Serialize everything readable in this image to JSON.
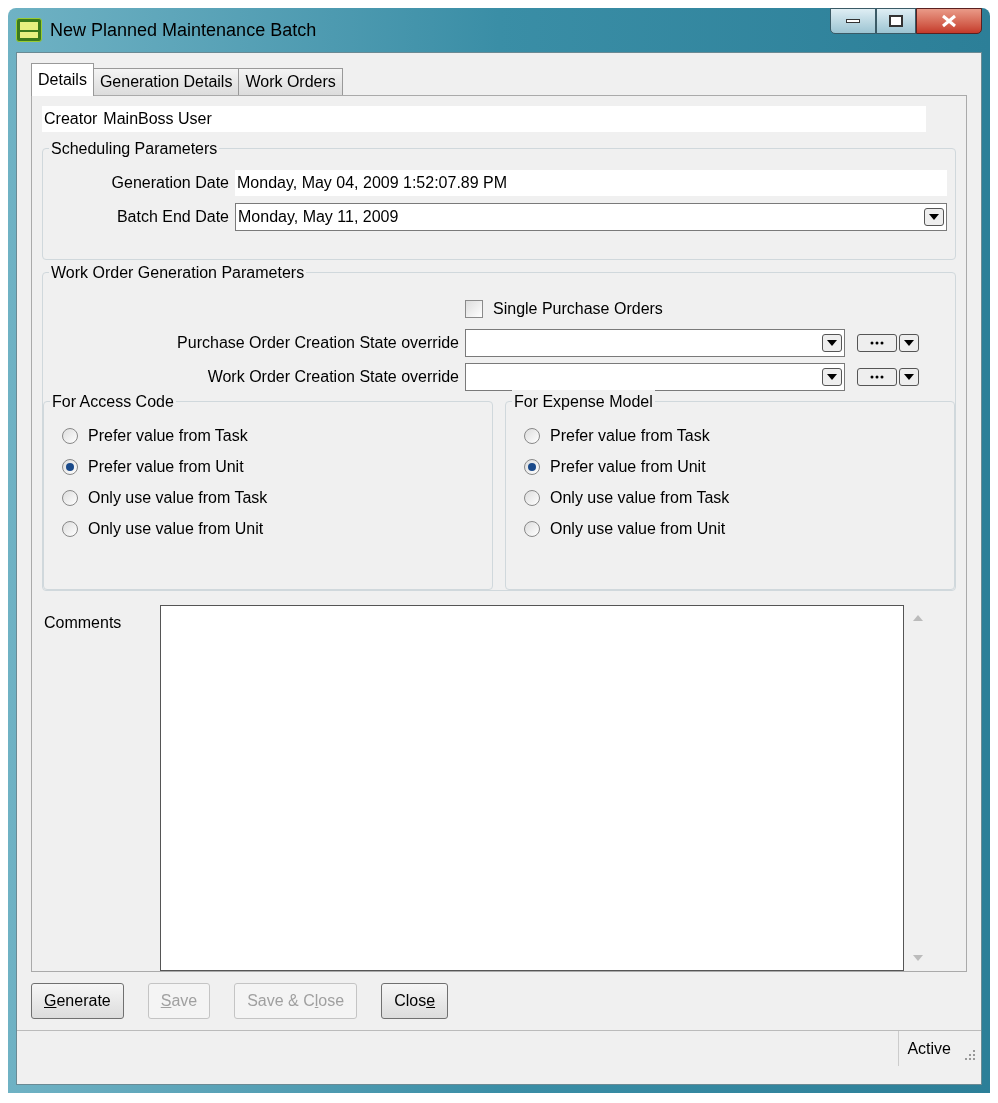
{
  "window": {
    "title": "New Planned Maintenance Batch"
  },
  "tabs": [
    {
      "label": "Details",
      "selected": true
    },
    {
      "label": "Generation Details",
      "selected": false
    },
    {
      "label": "Work Orders",
      "selected": false
    }
  ],
  "creator": {
    "label": "Creator",
    "value": "MainBoss User"
  },
  "scheduling": {
    "title": "Scheduling Parameters",
    "generation_date": {
      "label": "Generation Date",
      "value": "Monday, May 04, 2009 1:52:07.89 PM"
    },
    "batch_end_date": {
      "label": "Batch End Date",
      "value": "Monday, May 11, 2009"
    }
  },
  "generation": {
    "title": "Work Order Generation Parameters",
    "single_purchase_orders": {
      "label": "Single Purchase Orders",
      "checked": false
    },
    "overrides": [
      {
        "label": "Purchase Order Creation State override"
      },
      {
        "label": "Work Order Creation State override"
      }
    ],
    "groups": [
      {
        "title": "For Access Code",
        "options": [
          {
            "label": "Prefer value from Task",
            "selected": false
          },
          {
            "label": "Prefer value from Unit",
            "selected": true
          },
          {
            "label": "Only use value from Task",
            "selected": false
          },
          {
            "label": "Only use value from Unit",
            "selected": false
          }
        ]
      },
      {
        "title": "For Expense Model",
        "options": [
          {
            "label": "Prefer value from Task",
            "selected": false
          },
          {
            "label": "Prefer value from Unit",
            "selected": true
          },
          {
            "label": "Only use value from Task",
            "selected": false
          },
          {
            "label": "Only use value from Unit",
            "selected": false
          }
        ]
      }
    ]
  },
  "comments": {
    "label": "Comments"
  },
  "buttons": [
    {
      "access_key": "G",
      "after": "enerate",
      "disabled": false
    },
    {
      "access_key": "S",
      "after": "ave",
      "disabled": true
    },
    {
      "before": "Save & C",
      "access_key": "l",
      "after": "ose",
      "disabled": true
    },
    {
      "before": "Clos",
      "access_key": "e",
      "disabled": false
    }
  ],
  "status_bar": {
    "text": "Active"
  }
}
